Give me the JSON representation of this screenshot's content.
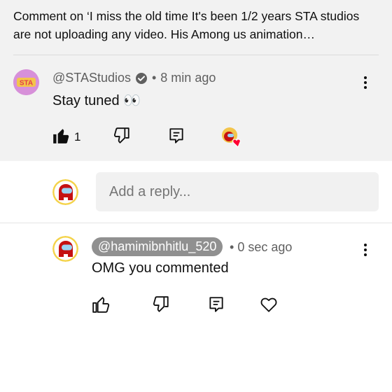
{
  "context": {
    "text": "Comment on ‘I miss the old time It's been 1/2 years STA studios are not uploading any video. His Among us animation…"
  },
  "top_comment": {
    "author": "@STAStudios",
    "separator": "•",
    "time": "8 min ago",
    "text": "Stay tuned 👀",
    "likes": "1",
    "avatar_text": "STA"
  },
  "reply_box": {
    "placeholder": "Add a reply..."
  },
  "reply_comment": {
    "mention": "@hamimibnhitlu_520",
    "separator": "•",
    "time": "0 sec ago",
    "text": "OMG you commented"
  },
  "colors": {
    "header_bg": "#f2f2f2",
    "mention_bg": "#909090",
    "heart": "#ff0033",
    "crewmate_red": "#c51111",
    "visor": "#9bd3f2"
  }
}
